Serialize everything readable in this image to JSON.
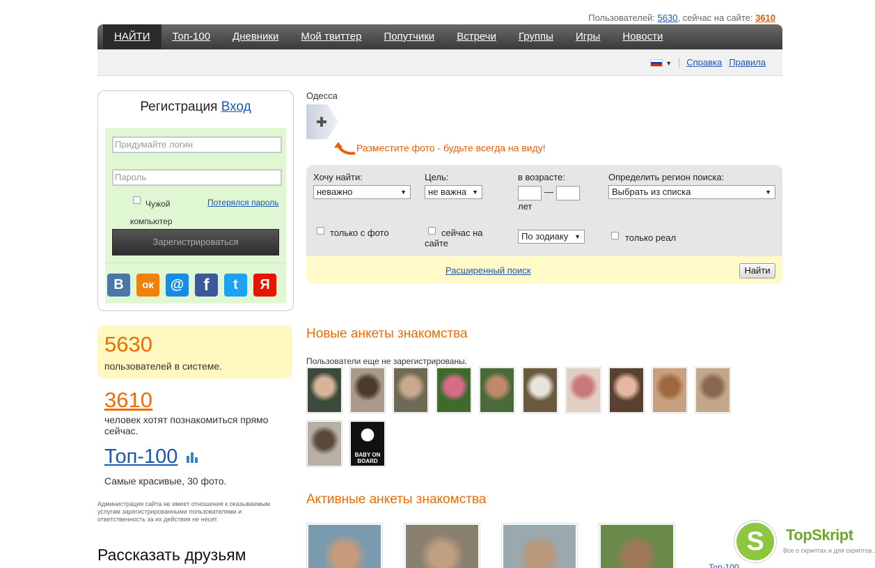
{
  "top_stats": {
    "users_label": "Пользователей: ",
    "users_count": "5630",
    "online_label": ", сейчас на сайте: ",
    "online_count": "3610"
  },
  "nav": {
    "items": [
      "НАЙТИ",
      "Топ-100",
      "Дневники",
      "Мой твиттер",
      "Попутчики",
      "Встречи",
      "Группы",
      "Игры",
      "Новости"
    ]
  },
  "subbar": {
    "help": "Справка",
    "rules": "Правила"
  },
  "registration": {
    "title": "Регистрация",
    "login_link": "Вход",
    "login_placeholder": "Придумайте логин",
    "password_placeholder": "Пароль",
    "foreign_computer": "Чужой компьютер",
    "lost_password": "Потерялся пароль",
    "register_button": "Зарегистрироваться",
    "socials": [
      {
        "name": "vkontakte",
        "glyph": "В",
        "color": "#4a76a8"
      },
      {
        "name": "odnoklassniki",
        "glyph": "ок",
        "color": "#ee8208"
      },
      {
        "name": "mailru",
        "glyph": "@",
        "color": "#168de2"
      },
      {
        "name": "facebook",
        "glyph": "f",
        "color": "#3b5998"
      },
      {
        "name": "twitter",
        "glyph": "t",
        "color": "#1da1f2"
      },
      {
        "name": "yandex",
        "glyph": "Я",
        "color": "#e61400"
      }
    ]
  },
  "left_stats": {
    "users_count": "5630",
    "users_text": "пользователей в системе.",
    "online_count": "3610",
    "online_text": "человек хотят познакомиться прямо сейчас.",
    "top100_link": "Топ-100",
    "top100_text": "Самые красивые, 30 фото.",
    "disclaimer": "Администрация сайта не имеет отношения к оказываемым услугам зарегистрированными пользователями и ответственность за их действия не несет.",
    "tell_friends": "Рассказать друзьям"
  },
  "profile": {
    "city": "Одесса",
    "place_photo": "Разместите фото - будьте всегда на виду!"
  },
  "search": {
    "want_label": "Хочу найти:",
    "want_value": "неважно",
    "goal_label": "Цель:",
    "goal_value": "не важна",
    "age_label": "в возрасте:",
    "age_dash": "—",
    "age_unit": "лет",
    "region_label": "Определить регион поиска:",
    "region_value": "Выбрать из списка",
    "with_photo": "только с фото",
    "online_now": "сейчас на сайте",
    "zodiac_value": "По зодиаку",
    "only_real": "только реал",
    "advanced": "Расширенный поиск",
    "find_button": "Найти"
  },
  "new_profiles": {
    "title": "Новые анкеты знакомства",
    "subtitle": "Пользователи еще не зарегистрированы.",
    "thumbs": [
      {
        "color": "#3b4a3a",
        "accent": "#d8b49a"
      },
      {
        "color": "#a99a8c",
        "accent": "#4b3a30"
      },
      {
        "color": "#6f6a55",
        "accent": "#caa88c"
      },
      {
        "color": "#3f6a2c",
        "accent": "#d86a8a"
      },
      {
        "color": "#4a6a3a",
        "accent": "#c08a68"
      },
      {
        "color": "#6c5a40",
        "accent": "#e8e4dc"
      },
      {
        "color": "#e2cfc4",
        "accent": "#c87878"
      },
      {
        "color": "#5a4030",
        "accent": "#e4b8a0"
      },
      {
        "color": "#c8a080",
        "accent": "#a06840"
      },
      {
        "color": "#c2a88a",
        "accent": "#8a6850"
      },
      {
        "color": "#b8b0a4",
        "accent": "#5a4a3c"
      }
    ],
    "baby_text": "BABY ON BOARD"
  },
  "active_profiles": {
    "title": "Активные анкеты знакомства",
    "thumbs": [
      {
        "color": "#7a9ab0",
        "accent": "#c89a7a"
      },
      {
        "color": "#8a8070",
        "accent": "#c0a080"
      },
      {
        "color": "#9aa8b0",
        "accent": "#b89878"
      },
      {
        "color": "#6a8a4a",
        "accent": "#a07858"
      }
    ],
    "top100_link": "Топ-100"
  },
  "watermark": {
    "glyph": "S",
    "name": "TopSkript",
    "tagline": "Все о скриптах и для скриптов..."
  },
  "colors": {
    "accent_orange": "#f26b00",
    "link_blue": "#1a56b6",
    "nav_dark": "#3a3a3a"
  }
}
